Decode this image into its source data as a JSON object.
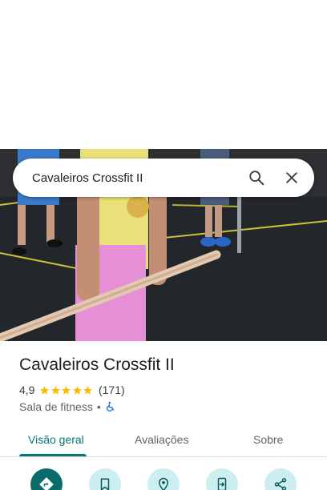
{
  "search": {
    "query": "Cavaleiros Crossfit II"
  },
  "place": {
    "name": "Cavaleiros Crossfit II",
    "rating": "4,9",
    "stars": 5,
    "review_count": "(171)",
    "category": "Sala de fitness",
    "separator": "•"
  },
  "tabs": [
    {
      "label": "Visão geral",
      "active": true
    },
    {
      "label": "Avaliações",
      "active": false
    },
    {
      "label": "Sobre",
      "active": false
    }
  ],
  "actions": [
    {
      "icon": "directions-icon"
    },
    {
      "icon": "bookmark-icon"
    },
    {
      "icon": "nearby-pin-icon"
    },
    {
      "icon": "send-to-phone-icon"
    },
    {
      "icon": "share-icon"
    }
  ],
  "colors": {
    "accent": "#0b7474",
    "star": "#fbbc04",
    "chip_bg": "#cdeef0",
    "accessibility": "#1a73e8"
  }
}
